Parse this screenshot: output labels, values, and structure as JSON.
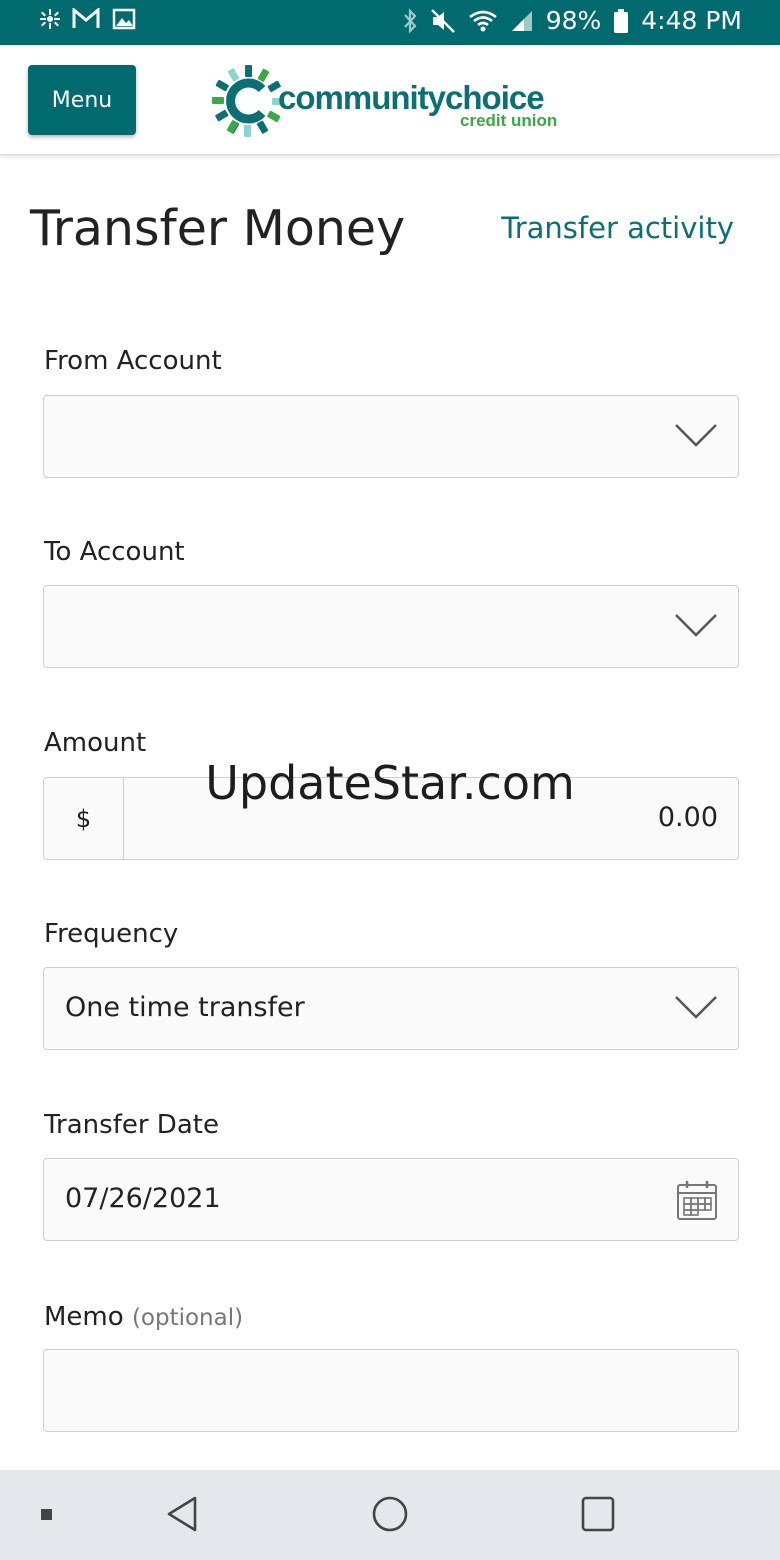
{
  "status_bar": {
    "battery": "98%",
    "time": "4:48 PM",
    "left_icons": [
      "pinwheel-icon",
      "gmail-icon",
      "image-icon"
    ],
    "right_icons": [
      "bluetooth-icon",
      "mute-icon",
      "wifi-icon",
      "signal-icon",
      "battery-icon"
    ]
  },
  "header": {
    "menu_label": "Menu",
    "logo_main": "communitychoice",
    "logo_sub": "credit union",
    "brand_color": "#006a6e",
    "logo_green": "#3aa845"
  },
  "page": {
    "title": "Transfer Money",
    "activity_link": "Transfer activity"
  },
  "form": {
    "from_account": {
      "label": "From Account",
      "value": ""
    },
    "to_account": {
      "label": "To Account",
      "value": ""
    },
    "amount": {
      "label": "Amount",
      "currency": "$",
      "value": "0.00"
    },
    "frequency": {
      "label": "Frequency",
      "value": "One time transfer"
    },
    "transfer_date": {
      "label": "Transfer Date",
      "value": "07/26/2021"
    },
    "memo": {
      "label": "Memo",
      "optional": "(optional)",
      "value": ""
    }
  },
  "watermark": "UpdateStar.com",
  "nav_bar": {
    "icons": [
      "recents-dot-icon",
      "back-icon",
      "home-icon",
      "overview-icon"
    ]
  }
}
